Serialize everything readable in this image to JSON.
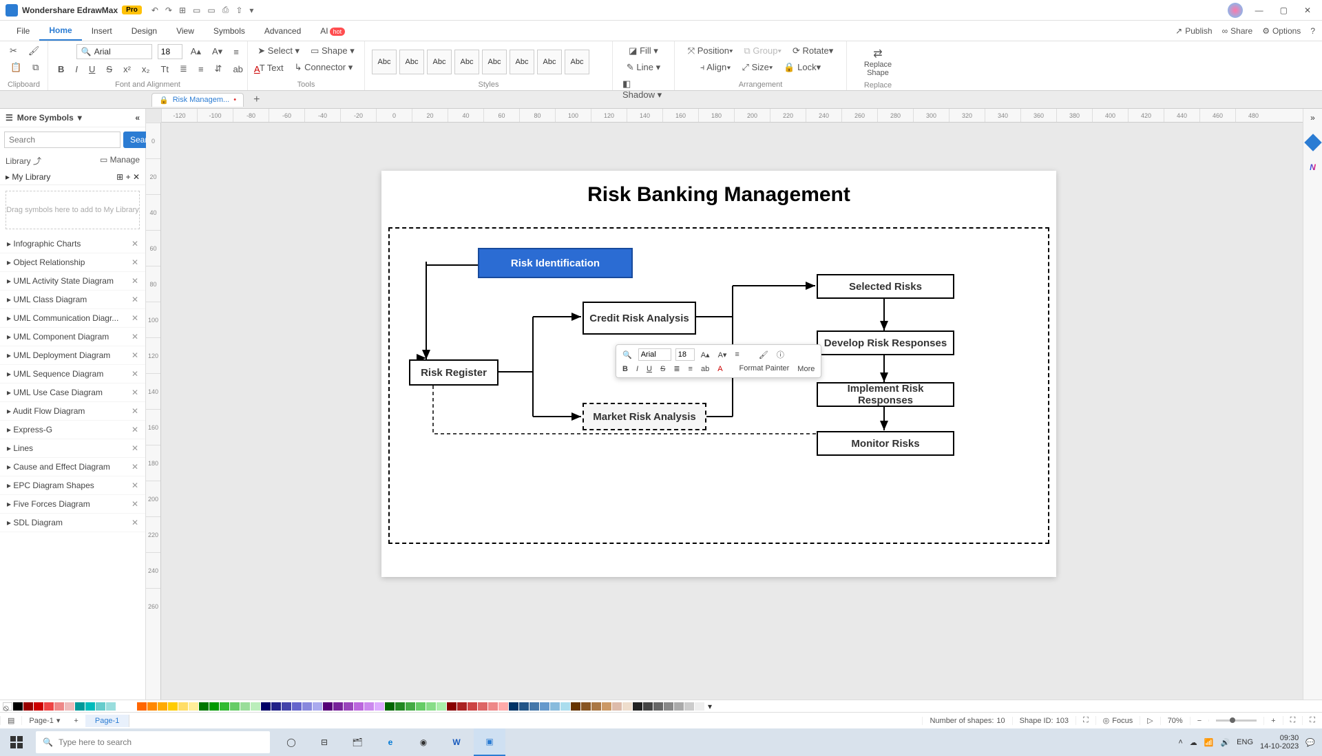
{
  "app": {
    "name": "Wondershare EdrawMax",
    "badge": "Pro"
  },
  "window": {
    "minimize": "—",
    "maximize": "▢",
    "close": "✕"
  },
  "qat": {
    "undo": "↶",
    "redo": "↷",
    "new": "⊞",
    "open": "▭",
    "save": "▭",
    "print": "⎙",
    "export": "⇧",
    "more": "▾"
  },
  "menus": {
    "file": "File",
    "home": "Home",
    "insert": "Insert",
    "design": "Design",
    "view": "View",
    "symbols": "Symbols",
    "advanced": "Advanced",
    "ai": "AI",
    "ai_badge": "hot"
  },
  "menu_right": {
    "publish": "Publish",
    "share": "Share",
    "options": "Options"
  },
  "ribbon": {
    "clipboard": {
      "label": "Clipboard",
      "cut": "✂",
      "brush": "🖌",
      "paste": "📋",
      "copy": "⧉"
    },
    "font": {
      "label": "Font and Alignment",
      "name": "Arial",
      "size": "18",
      "incsize": "A▴",
      "decsize": "A▾",
      "align": "≡",
      "bold": "B",
      "italic": "I",
      "underline": "U",
      "strike": "S",
      "sup": "x²",
      "sub": "x₂",
      "caseBtn": "Tt",
      "bullets": "≣",
      "numbers": "≡",
      "spacing": "⇵",
      "ab": "ab",
      "fontcolor": "A"
    },
    "tools": {
      "label": "Tools",
      "select": "Select",
      "shape": "Shape",
      "text": "Text",
      "connector": "Connector"
    },
    "styles": {
      "label": "Styles",
      "swatch": "Abc"
    },
    "shape_style": {
      "fill": "Fill",
      "line": "Line",
      "shadow": "Shadow"
    },
    "arrange": {
      "label": "Arrangement",
      "position": "Position",
      "group": "Group",
      "rotate": "Rotate",
      "align": "Align",
      "size": "Size",
      "lock": "Lock"
    },
    "replace": {
      "label": "Replace",
      "shape": "Replace Shape"
    }
  },
  "doc_tab": {
    "title": "Risk Managem...",
    "unsaved": "•",
    "add": "+"
  },
  "ruler_h": [
    "-120",
    "-100",
    "-80",
    "-60",
    "-40",
    "-20",
    "0",
    "20",
    "40",
    "60",
    "80",
    "100",
    "120",
    "140",
    "160",
    "180",
    "200",
    "220",
    "240",
    "260",
    "280",
    "300",
    "320",
    "340",
    "360",
    "380",
    "400",
    "420",
    "440",
    "460",
    "480"
  ],
  "ruler_v": [
    "0",
    "20",
    "40",
    "60",
    "80",
    "100",
    "120",
    "140",
    "160",
    "180",
    "200",
    "220",
    "240",
    "260"
  ],
  "sidebar": {
    "header": "More Symbols",
    "collapse": "«",
    "search_placeholder": "Search",
    "search_btn": "Search",
    "library_label": "Library",
    "manage": "Manage",
    "mylib": "My Library",
    "dropzone": "Drag symbols here to add to My Library",
    "cats": [
      "Infographic Charts",
      "Object Relationship",
      "UML Activity State Diagram",
      "UML Class Diagram",
      "UML Communication Diagr...",
      "UML Component Diagram",
      "UML Deployment Diagram",
      "UML Sequence Diagram",
      "UML Use Case Diagram",
      "Audit Flow Diagram",
      "Express-G",
      "Lines",
      "Cause and Effect Diagram",
      "EPC Diagram Shapes",
      "Five Forces Diagram",
      "SDL Diagram"
    ]
  },
  "diagram": {
    "title": "Risk Banking Management",
    "nodes": {
      "risk_identification": "Risk Identification",
      "risk_register": "Risk Register",
      "credit_risk": "Credit Risk Analysis",
      "market_risk": "Market Risk Analysis",
      "selected_risks": "Selected Risks",
      "develop": "Develop Risk Responses",
      "implement": "Implement Risk Responses",
      "monitor": "Monitor Risks"
    }
  },
  "minibar": {
    "font": "Arial",
    "size": "18",
    "inc": "A▴",
    "dec": "A▾",
    "align": "≡",
    "brush": "🖌",
    "info": "ⓘ",
    "bold": "B",
    "italic": "I",
    "underline": "U",
    "strike": "S",
    "bullets": "≣",
    "numbers": "≡",
    "ab": "ab",
    "color": "A",
    "format_painter": "Format Painter",
    "more": "More"
  },
  "colors": [
    "#000",
    "#900",
    "#c00",
    "#e44",
    "#e88",
    "#ebb",
    "#099",
    "#0bb",
    "#6cc",
    "#9dd",
    "#bdede",
    "#fff",
    "#f60",
    "#f80",
    "#fa0",
    "#fc0",
    "#fd6",
    "#fe9",
    "#070",
    "#090",
    "#3b3",
    "#6c6",
    "#9d9",
    "#beb",
    "#006",
    "#228",
    "#44a",
    "#66c",
    "#88d",
    "#aae",
    "#507",
    "#729",
    "#94b",
    "#b6d",
    "#c8e",
    "#daf",
    "#060",
    "#282",
    "#4a4",
    "#6c6",
    "#8d8",
    "#aea",
    "#800",
    "#a22",
    "#c44",
    "#d66",
    "#e88",
    "#faa",
    "#036",
    "#258",
    "#47a",
    "#69c",
    "#8bd",
    "#ade",
    "#630",
    "#852",
    "#a74",
    "#c96",
    "#dba",
    "#edc",
    "#222",
    "#444",
    "#666",
    "#888",
    "#aaa",
    "#ccc",
    "#eee"
  ],
  "statusbar": {
    "page_selector": "Page-1",
    "add": "+",
    "page_tab": "Page-1",
    "shapes_label": "Number of shapes:",
    "shapes": "10",
    "shapeid_label": "Shape ID:",
    "shapeid": "103",
    "fit": "⛶",
    "focus": "Focus",
    "play": "▷",
    "zoom": "70%",
    "zoom_out": "−",
    "zoom_in": "+",
    "full1": "⛶",
    "full2": "⛶"
  },
  "taskbar": {
    "search_placeholder": "Type here to search",
    "time": "09:30",
    "date": "14-10-2023",
    "lang": "ENG",
    "icons": {
      "cortana": "◯",
      "tasks": "⊟",
      "files": "🗂",
      "edge": "e",
      "chrome": "◉",
      "word": "W",
      "app": "▣"
    }
  }
}
